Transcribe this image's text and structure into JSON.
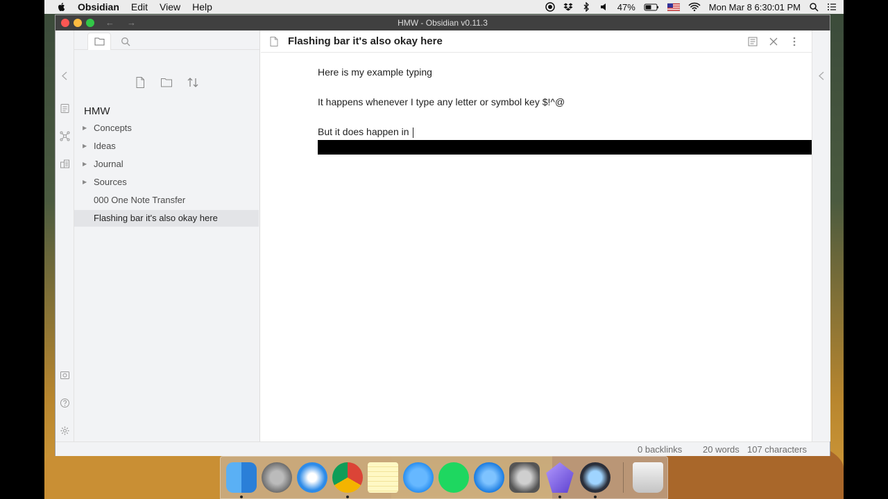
{
  "menubar": {
    "app_name": "Obsidian",
    "items": [
      "Edit",
      "View",
      "Help"
    ],
    "battery": "47%",
    "datetime": "Mon Mar 8  6:30:01 PM"
  },
  "window": {
    "title": "HMW - Obsidian v0.11.3"
  },
  "explorer": {
    "vault_name": "HMW",
    "folders": [
      "Concepts",
      "Ideas",
      "Journal",
      "Sources"
    ],
    "files": [
      "000 One Note Transfer",
      "Flashing bar it's also okay here"
    ],
    "active_file": "Flashing bar it's also okay here"
  },
  "editor": {
    "title": "Flashing bar it's also okay here",
    "lines": [
      "Here is my example typing",
      "It happens whenever I type any letter or symbol key $!^@",
      "But it does happen in "
    ]
  },
  "status": {
    "backlinks": "0 backlinks",
    "words": "20 words",
    "characters": "107 characters"
  },
  "dock": {
    "apps": [
      "finder",
      "launchpad",
      "safari",
      "chrome",
      "notes",
      "messages",
      "spotify",
      "app-store",
      "system-preferences",
      "obsidian",
      "quicktime",
      "trash"
    ]
  }
}
